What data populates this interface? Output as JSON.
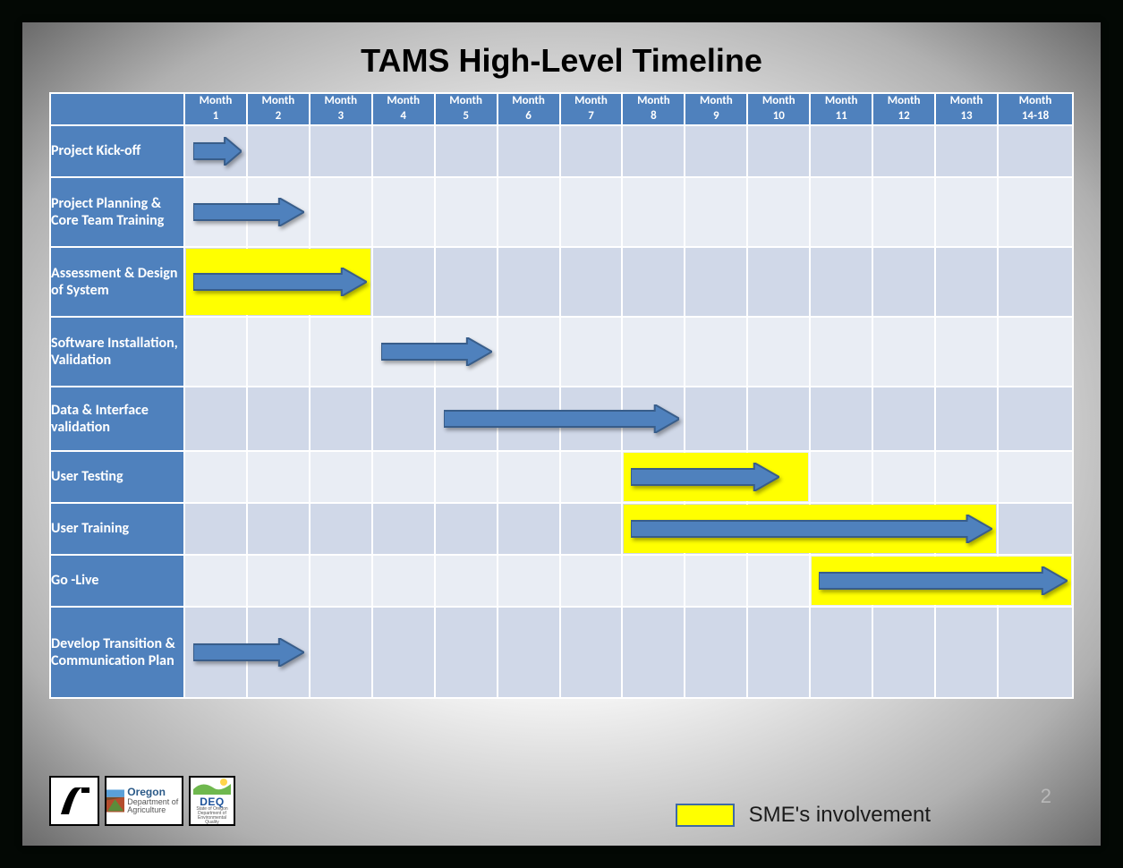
{
  "title": "TAMS High-Level Timeline",
  "page_number": "2",
  "legend": {
    "label": "SME's involvement"
  },
  "colors": {
    "header_fill": "#4f81bd",
    "row_odd": "#d0d8e8",
    "row_even": "#e9edf4",
    "sme_highlight": "#ffff00",
    "arrow_fill": "#4f81bd",
    "arrow_border": "#385d8a"
  },
  "logos": {
    "odot": "ODOT",
    "oda": "Oregon Department of Agriculture",
    "deq": "DEQ State of Oregon Department of Environmental Quality"
  },
  "chart_data": {
    "type": "table",
    "title": "TAMS High-Level Timeline",
    "xlabel": "",
    "ylabel": "",
    "categories": [
      "Month 1",
      "Month 2",
      "Month 3",
      "Month 4",
      "Month 5",
      "Month 6",
      "Month 7",
      "Month 8",
      "Month 9",
      "Month 10",
      "Month 11",
      "Month 12",
      "Month 13",
      "Month 14-18"
    ],
    "header": {
      "word": "Month",
      "numbers": [
        "1",
        "2",
        "3",
        "4",
        "5",
        "6",
        "7",
        "8",
        "9",
        "10",
        "11",
        "12",
        "13",
        "14-18"
      ]
    },
    "series": [
      {
        "name": "Project Kick-off",
        "start": 1,
        "end": 1,
        "sme": false
      },
      {
        "name": "Project Planning & Core Team Training",
        "start": 1,
        "end": 2,
        "sme": false
      },
      {
        "name": "Assessment & Design of System",
        "start": 1,
        "end": 3,
        "sme": true
      },
      {
        "name": "Software Installation, Validation",
        "start": 4,
        "end": 5,
        "sme": false
      },
      {
        "name": "Data & Interface validation",
        "start": 5,
        "end": 8,
        "sme": false
      },
      {
        "name": "User Testing",
        "start": 8,
        "end": 10,
        "sme": true
      },
      {
        "name": "User Training",
        "start": 8,
        "end": 13,
        "sme": true
      },
      {
        "name": "Go -Live",
        "start": 11,
        "end": 14,
        "sme": true
      },
      {
        "name": "Develop Transition & Communication Plan",
        "start": 1,
        "end": 2,
        "sme": false
      }
    ]
  }
}
